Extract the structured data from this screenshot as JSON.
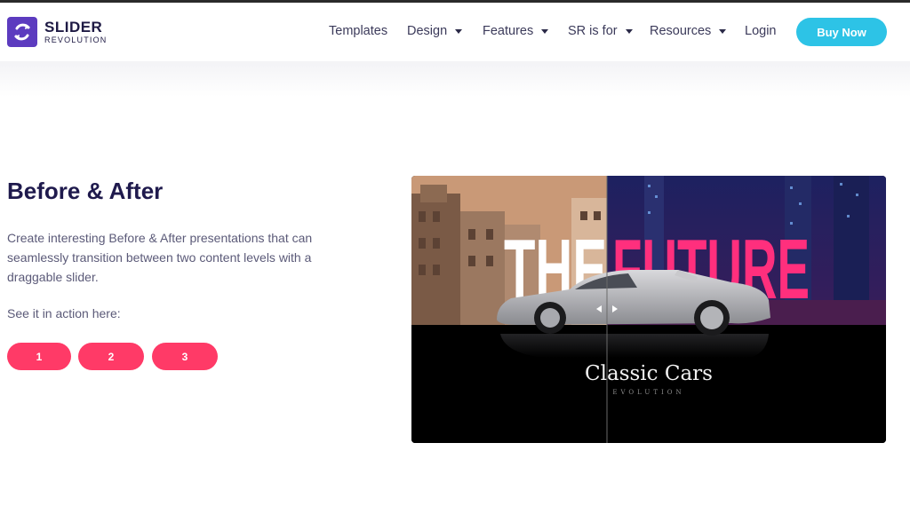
{
  "header": {
    "logo": {
      "word1": "SLIDER",
      "word2": "REVOLUTION",
      "icon": "refresh-icon",
      "color": "#5c3bbf"
    },
    "nav": [
      {
        "label": "Templates",
        "dropdown": false
      },
      {
        "label": "Design",
        "dropdown": true
      },
      {
        "label": "Features",
        "dropdown": true
      },
      {
        "label": "SR is for",
        "dropdown": true
      },
      {
        "label": "Resources",
        "dropdown": true
      },
      {
        "label": "Login",
        "dropdown": false
      }
    ],
    "buy_label": "Buy Now",
    "buy_color": "#2dc3e6"
  },
  "main": {
    "title": "Before & After",
    "description": "Create interesting Before & After presentations that can seamlessly transition between two content levels with a draggable slider.",
    "see_label": "See it in action here:",
    "buttons": [
      "1",
      "2",
      "3"
    ],
    "button_color": "#ff3a67"
  },
  "slider": {
    "word_before": "THE",
    "word_after": "FUTURE",
    "caption_title": "Classic Cars",
    "caption_sub": "EVOLUTION",
    "accent": "#ff2f7d",
    "before_tone": "#c99977"
  }
}
